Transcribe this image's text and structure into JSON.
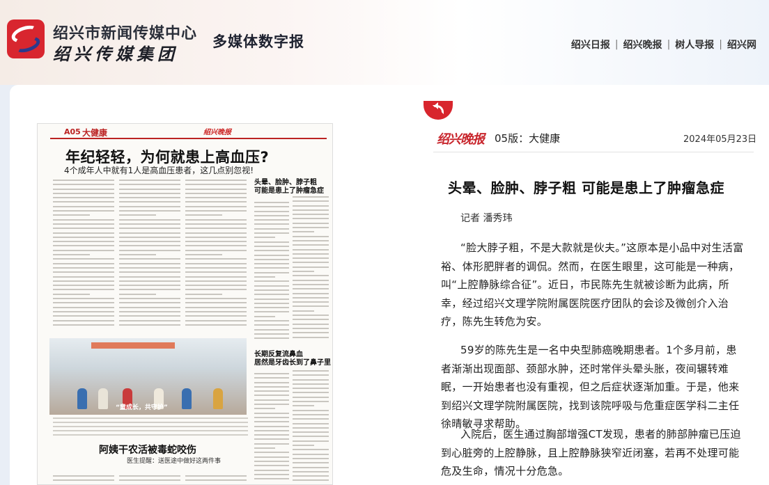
{
  "header": {
    "logo_line1": "绍兴市新闻传媒中心",
    "logo_line2": "绍兴传媒集团",
    "site_title": "多媒体数字报",
    "links": [
      "绍兴日报",
      "绍兴晚报",
      "树人导报",
      "绍兴网"
    ],
    "separator": "|"
  },
  "newspaper_page": {
    "page_number": "A05",
    "section": "大健康",
    "brand": "绍兴晚报",
    "headline": "年纪轻轻，为何就患上高血压?",
    "subheadline": "4个成年人中就有1人是高血压患者，这几点别忽视!",
    "side_story_1_headline": [
      "头晕、脸肿、脖子粗",
      "可能是患上了肿瘤急症"
    ],
    "side_story_2_headline": [
      "长期反复流鼻血",
      "居然是牙齿长到了鼻子里"
    ],
    "photo_caption": "“童成长，共守护”",
    "story_3_headline": "阿姨干农活被毒蛇咬伤",
    "story_3_subheadline": "医生提醒：送医途中做好这两件事"
  },
  "article": {
    "back_icon": "back-arrow-icon",
    "brand": "绍兴晚报",
    "section": "05版：大健康",
    "date": "2024年05月23日",
    "title": "头晕、脸肿、脖子粗 可能是患上了肿瘤急症",
    "author": "记者 潘秀玮",
    "paragraphs": [
      "“脸大脖子粗，不是大款就是伙夫。”这原本是小品中对生活富裕、体形肥胖者的调侃。然而，在医生眼里，这可能是一种病，叫“上腔静脉综合征”。近日，市民陈先生就被诊断为此病，所幸，经过绍兴文理学院附属医院医疗团队的会诊及微创介入治疗，陈先生转危为安。",
      "59岁的陈先生是一名中央型肺癌晚期患者。1个多月前，患者渐渐出现面部、颈部水肿，还时常伴头晕头胀，夜间辗转难眠，一开始患者也没有重视，但之后症状逐渐加重。于是，他来到绍兴文理学院附属医院，找到该院呼吸与危重症医学科二主任徐晴敏寻求帮助。",
      "入院后，医生通过胸部增强CT发现，患者的肺部肿瘤已压迫到心脏旁的上腔静脉，且上腔静脉狭窄近闭塞，若再不处理可能危及生命，情况十分危急。"
    ]
  },
  "colors": {
    "brand_red": "#d8252d",
    "logo_blue": "#2b3a8c"
  }
}
